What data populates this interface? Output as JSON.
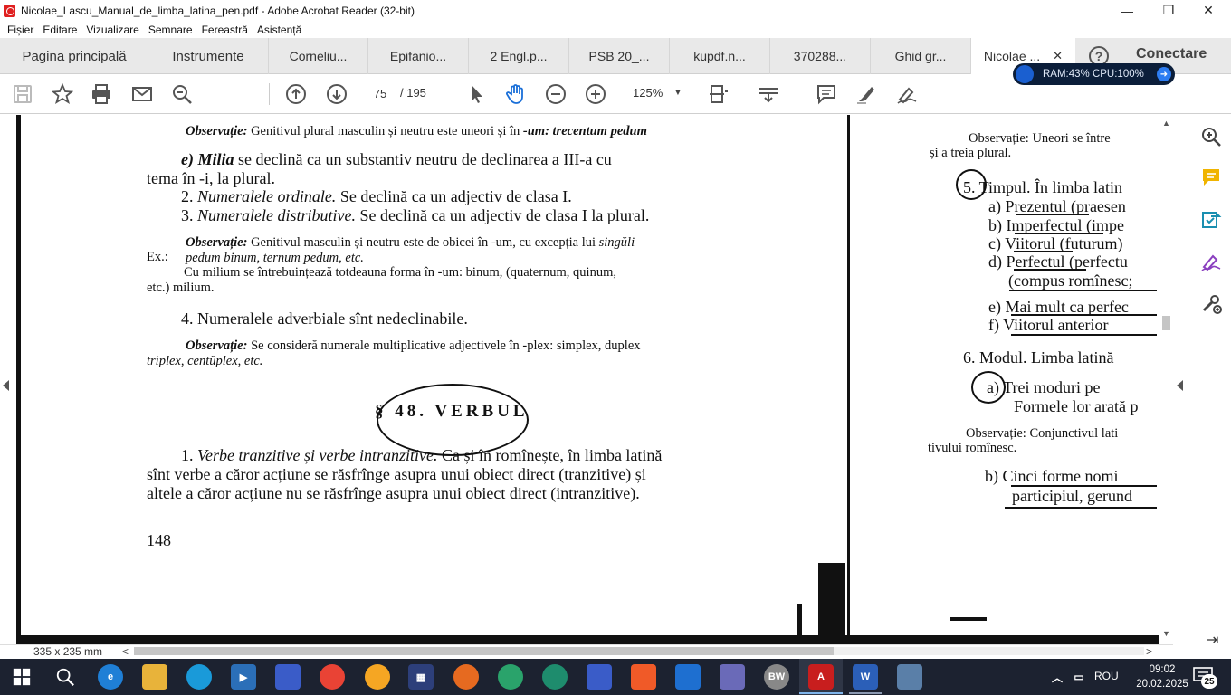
{
  "window": {
    "title": "Nicolae_Lascu_Manual_de_limba_latina_pen.pdf - Adobe Acrobat Reader (32-bit)",
    "minimize": "—",
    "maximize": "❐",
    "close": "✕"
  },
  "menu": [
    "Fișier",
    "Editare",
    "Vizualizare",
    "Semnare",
    "Fereastră",
    "Asistență"
  ],
  "tabs": {
    "home": "Pagina principală",
    "tools": "Instrumente",
    "docs": [
      "Corneliu...",
      "Epifanio...",
      "2 Engl.p...",
      "PSB 20_...",
      "kupdf.n...",
      "370288...",
      "Ghid gr...",
      "Nicolae ..."
    ],
    "active_close": "✕",
    "help": "?",
    "connect": "Conectare"
  },
  "toolbar": {
    "page_current": "75",
    "page_total": "/  195",
    "zoom": "125%",
    "zoom_caret": "▼"
  },
  "perf_widget": {
    "text": "RAM:43%  CPU:100%",
    "arrow": "➜"
  },
  "left_page": {
    "lines": [
      {
        "id": "obs1",
        "label": "Observație:",
        "text": " Genitivul plural masculin și neutru este uneori și în ",
        "tail": "-um: trecentum pedum"
      },
      {
        "id": "e1a",
        "lead": "e) Milia",
        "text": " se declină ca un substantiv neutru de declinarea a III-a cu"
      },
      {
        "id": "e1b",
        "text": "tema în -i, la plural."
      },
      {
        "id": "n2",
        "text": "2. ",
        "it": "Numeralele ordinale.",
        "rest": " Se declină ca un adjectiv de clasa I."
      },
      {
        "id": "n3",
        "text": "3. ",
        "it": "Numeralele distributive.",
        "rest": " Se declină ca un adjectiv de clasa I la plural."
      },
      {
        "id": "obs2a",
        "label": "Observație:",
        "text": " Genitivul masculin și neutru este de obicei în -um, cu excepția lui ",
        "tail": "singŭli"
      },
      {
        "id": "obs2b",
        "lead": "Ex.:",
        "text": "pedum binum, ternum pedum, etc."
      },
      {
        "id": "obs2c",
        "text": "Cu  milium  se  întrebuințează totdeauna forma în -um: binum,  (quaternum, quinum,"
      },
      {
        "id": "obs2d",
        "text": "etc.)  milium."
      },
      {
        "id": "n4",
        "text": "4. Numeralele adverbiale sînt nedeclinabile."
      },
      {
        "id": "obs3a",
        "label": "Observație:",
        "text": " Se consideră numerale multiplicative adjectivele în -plex: simplex, duplex"
      },
      {
        "id": "obs3b",
        "text": "triplex, centŭplex, etc."
      },
      {
        "id": "v1",
        "text": "1. ",
        "it": "Verbe tranzitive și verbe intranzitive.",
        "rest": " Ca și în romînește, în limba latină"
      },
      {
        "id": "v2",
        "text": "sînt verbe a căror acțiune se răsfrînge asupra unui obiect direct (tranzitive) și"
      },
      {
        "id": "v3",
        "text": "altele a căror acțiune nu se răsfrînge asupra unui obiect direct (intranzitive)."
      }
    ],
    "section_heading": "§ 48. VERBUL",
    "page_number": "148"
  },
  "right_page": {
    "obs_a": "Observație: Uneori se între",
    "obs_b": "și a treia plural.",
    "timpul": "5. Timpul. În limba latin",
    "items": [
      "a)  Prezentul  (praesen",
      "b)  Imperfectul  (impe",
      "c)  Viitorul  (futurum)",
      "d)  Perfectul  (perfectu",
      "(compus romînesc;",
      "e)  Mai mult ca perfec",
      "f)  Viitorul  anterior"
    ],
    "modul": "6. Modul. Limba latină",
    "trei_a": "a)  Trei   moduri   pe",
    "trei_b": "Formele lor arată p",
    "obs2_a": "Observație: Conjunctivul lati",
    "obs2_b": "tivului romînesc.",
    "cinci_a": "b)  Cinci forme nomi",
    "cinci_b": "participiul, gerund"
  },
  "status": {
    "dimensions": "335 x 235 mm",
    "scroll_left": "<",
    "scroll_right": ">"
  },
  "taskbar": {
    "language": "ROU",
    "time": "09:02",
    "date": "20.02.2025",
    "notifications": "25"
  },
  "colors": {
    "accent_red": "#e02020",
    "taskbar_bg": "#1c2230",
    "perf_bg": "#0b1e3a"
  }
}
